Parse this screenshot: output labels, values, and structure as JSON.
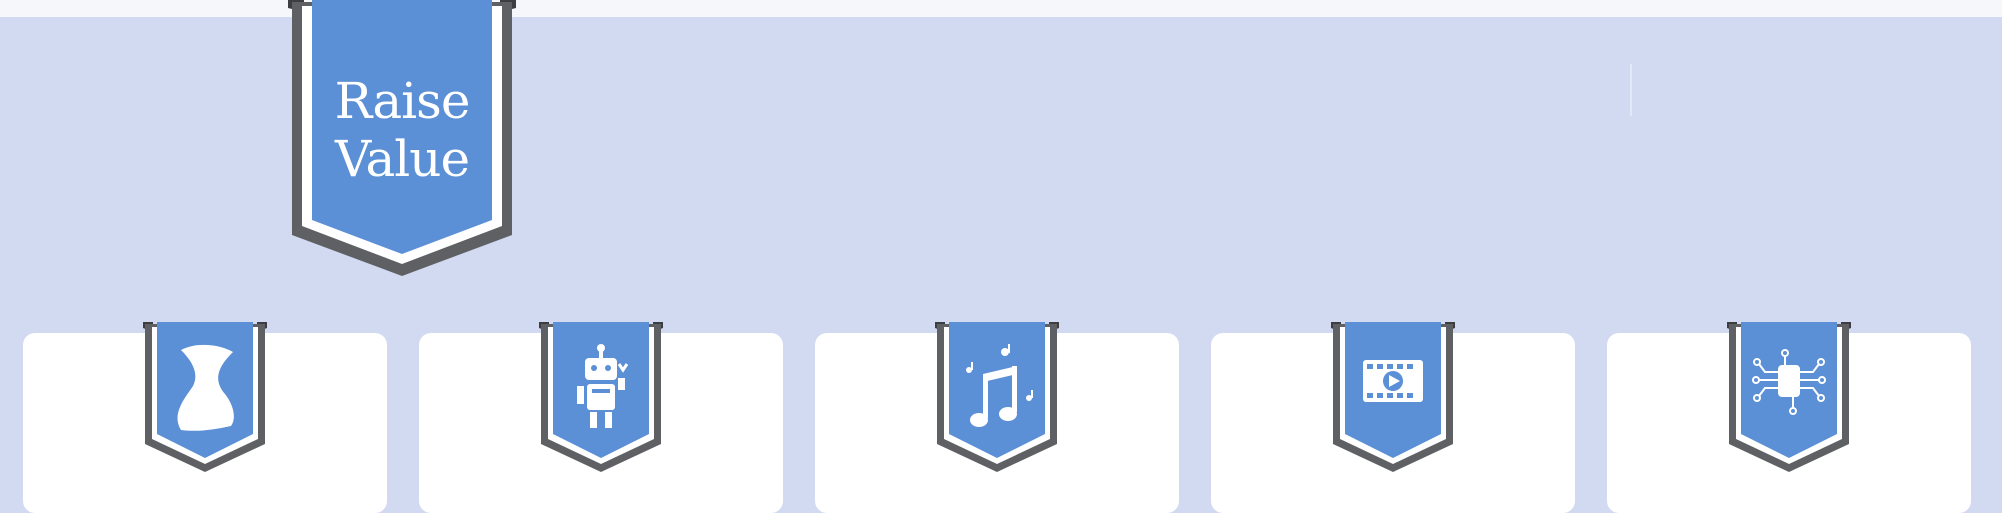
{
  "hero": {
    "label_line1": "Raise",
    "label_line2": "Value"
  },
  "colors": {
    "background": "#d2daf1",
    "ribbon_blue": "#5b8fd6",
    "ribbon_gray": "#5f6063",
    "card": "#ffffff"
  },
  "categories": [
    {
      "icon": "swoosh-icon"
    },
    {
      "icon": "robot-icon"
    },
    {
      "icon": "music-note-icon"
    },
    {
      "icon": "video-player-icon"
    },
    {
      "icon": "circuit-chip-icon"
    }
  ]
}
